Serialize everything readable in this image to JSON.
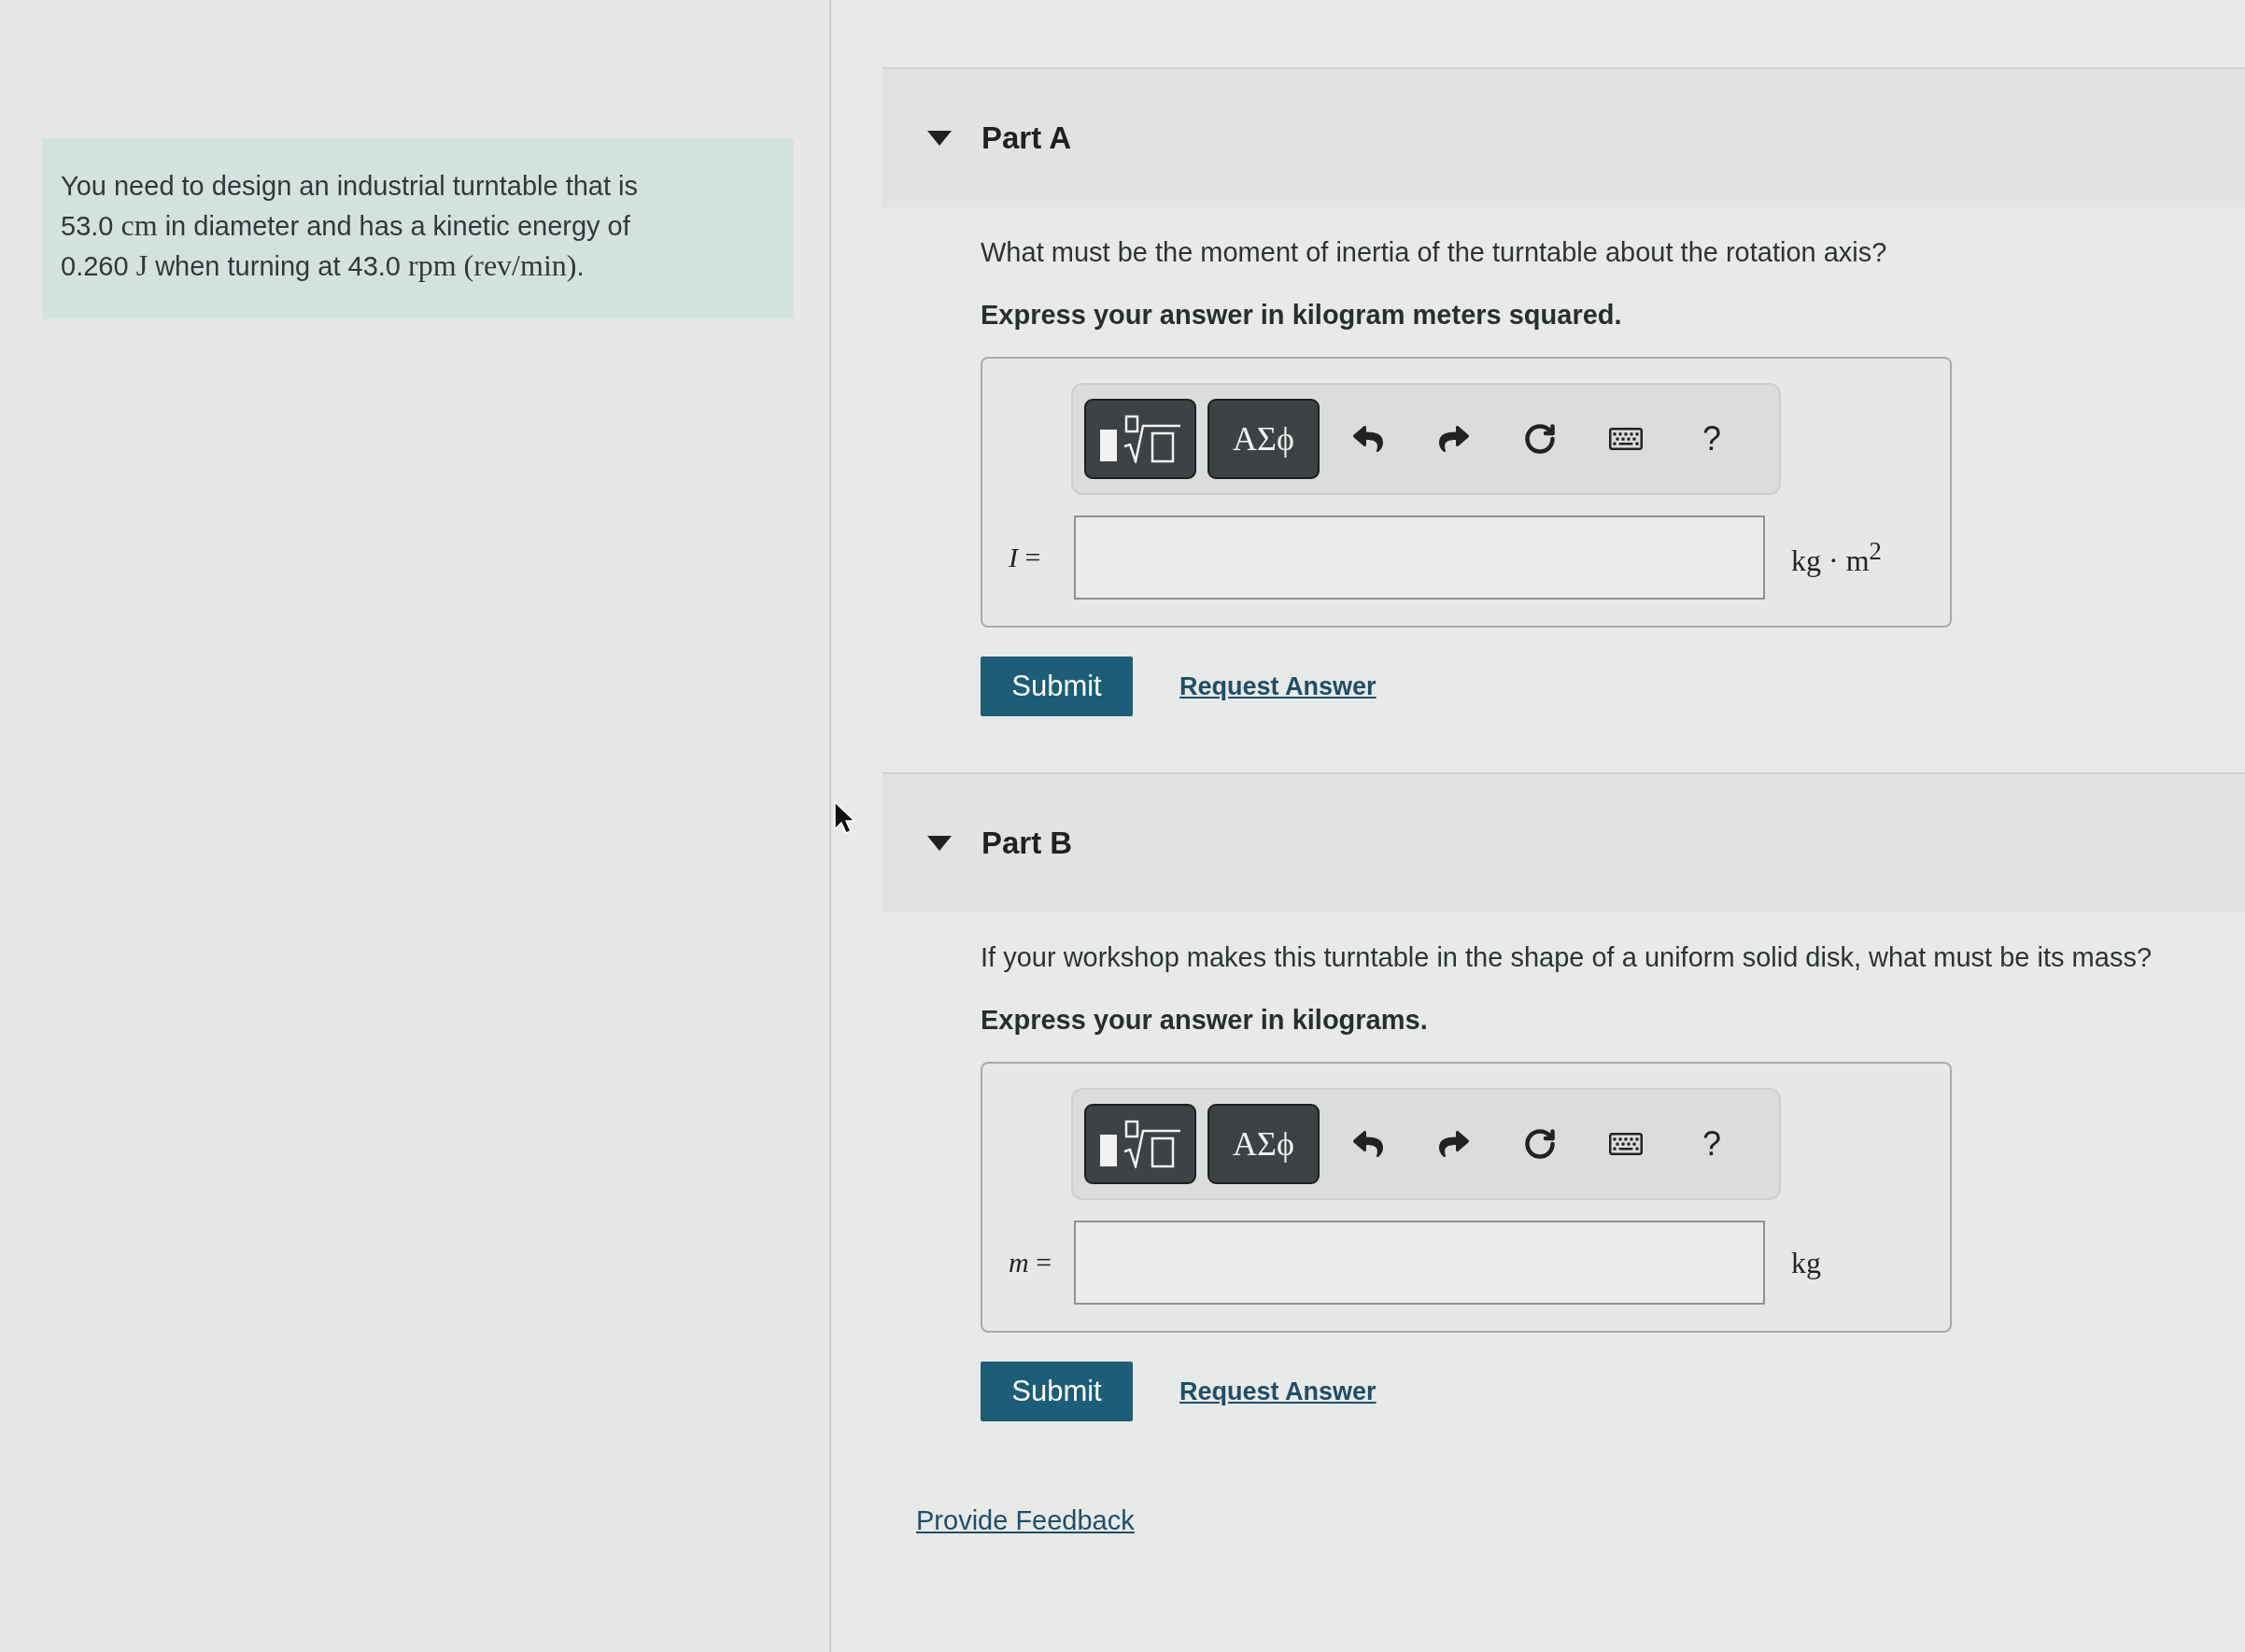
{
  "problem": {
    "segments": [
      {
        "kind": "text",
        "text": "You need to design an industrial turntable that is "
      },
      {
        "kind": "quantity",
        "value": "53.0",
        "unit": "cm"
      },
      {
        "kind": "text",
        "text": " in diameter and has a kinetic energy of "
      },
      {
        "kind": "quantity",
        "value": "0.260",
        "unit": "J"
      },
      {
        "kind": "text",
        "text": " when turning at "
      },
      {
        "kind": "quantity",
        "value": "43.0",
        "unit": "rpm (rev/min)"
      },
      {
        "kind": "text",
        "text": "."
      }
    ]
  },
  "parts": [
    {
      "label": "Part A",
      "expanded": true,
      "question": "What must be the moment of inertia of the turntable about the rotation axis?",
      "instruction": "Express your answer in kilogram meters squared.",
      "toolbar": {
        "symbols_button": "ΑΣϕ",
        "help_button": "?"
      },
      "answer": {
        "variable": "*I* =",
        "unit": "kg · m$^{2}$"
      },
      "submit": "Submit",
      "request_answer": "Request Answer"
    },
    {
      "label": "Part B",
      "expanded": true,
      "question": "If your workshop makes this turntable in the shape of a uniform solid disk, what must be its mass?",
      "instruction": "Express your answer in kilograms.",
      "toolbar": {
        "symbols_button": "ΑΣϕ",
        "help_button": "?"
      },
      "answer": {
        "variable": "*m* =",
        "unit": "kg"
      },
      "submit": "Submit",
      "request_answer": "Request Answer"
    }
  ],
  "feedback_link": "Provide Feedback"
}
